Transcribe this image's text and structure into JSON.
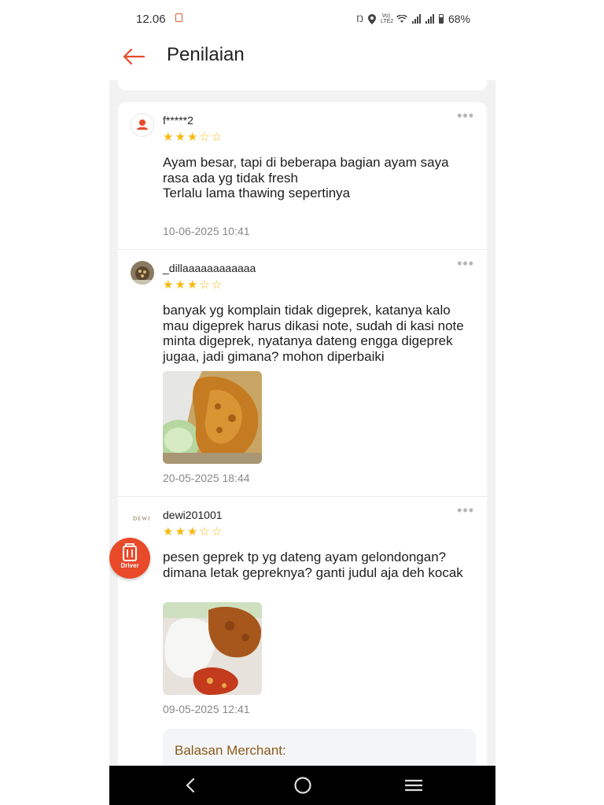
{
  "status_bar": {
    "time": "12.06",
    "network_label": "Vo) LTE2",
    "battery": "68%",
    "icons": [
      "notification-icon",
      "nfc-icon",
      "location-icon",
      "volte-icon",
      "wifi-icon",
      "signal-icon",
      "signal-icon",
      "battery-icon"
    ]
  },
  "header": {
    "title": "Penilaian",
    "back_icon": "arrow-left-icon"
  },
  "reviews": [
    {
      "username": "f*****2",
      "rating": 3,
      "max_rating": 5,
      "text": "Ayam besar, tapi di beberapa bagian ayam saya rasa ada yg tidak fresh\nTerlalu lama thawing sepertinya",
      "date": "10-06-2025 10:41",
      "has_photo": false
    },
    {
      "username": "_dillaaaaaaaaaaaa",
      "rating": 3,
      "max_rating": 5,
      "text": "banyak yg komplain tidak digeprek, katanya kalo mau digeprek harus dikasi note, sudah di kasi note minta digeprek, nyatanya dateng engga digeprek jugaa, jadi gimana? mohon diperbaiki",
      "date": "20-05-2025 18:44",
      "has_photo": true
    },
    {
      "username": "dewi201001",
      "avatar_text": "DEWI",
      "rating": 3,
      "max_rating": 5,
      "text": "pesen geprek tp yg dateng ayam gelondongan? dimana letak gepreknya? ganti judul aja deh kocak",
      "date": "09-05-2025 12:41",
      "has_photo": true,
      "merchant_reply_label": "Balasan Merchant:"
    }
  ],
  "driver_button": {
    "label": "Driver"
  },
  "colors": {
    "accent": "#e84a2a",
    "star": "#f5b90f",
    "merchant_label": "#8a5a1c",
    "background": "#f2f2f2"
  }
}
